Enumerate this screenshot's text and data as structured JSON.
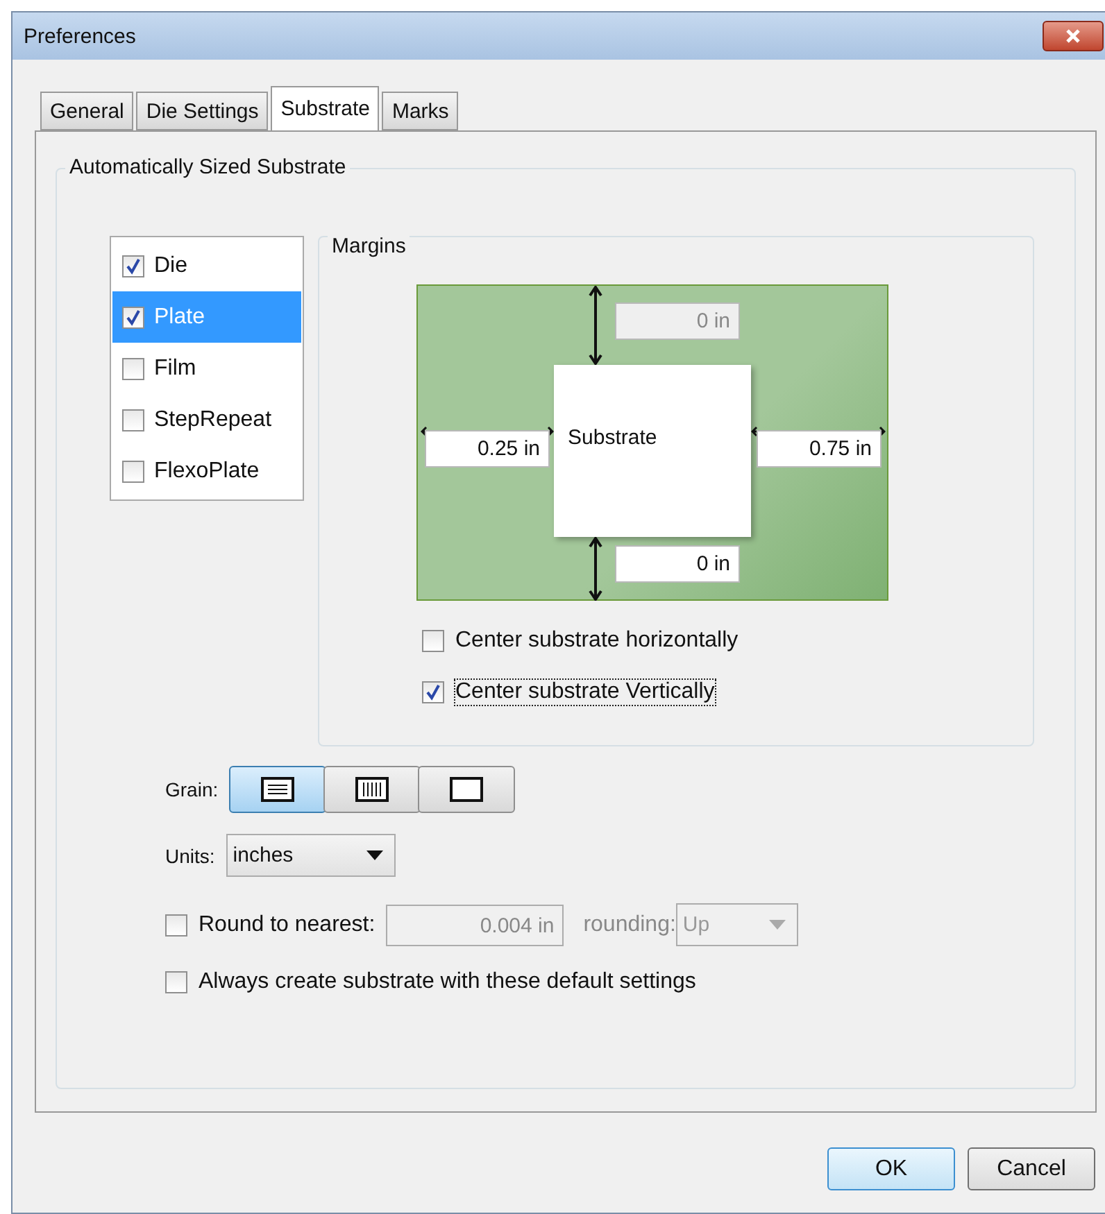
{
  "window": {
    "title": "Preferences"
  },
  "tabs": [
    {
      "label": "General",
      "selected": false
    },
    {
      "label": "Die Settings",
      "selected": false
    },
    {
      "label": "Substrate",
      "selected": true
    },
    {
      "label": "Marks",
      "selected": false
    }
  ],
  "group": {
    "title": "Automatically Sized Substrate"
  },
  "layers": [
    {
      "label": "Die",
      "checked": true,
      "selected": false
    },
    {
      "label": "Plate",
      "checked": true,
      "selected": true
    },
    {
      "label": "Film",
      "checked": false,
      "selected": false
    },
    {
      "label": "StepRepeat",
      "checked": false,
      "selected": false
    },
    {
      "label": "FlexoPlate",
      "checked": false,
      "selected": false
    }
  ],
  "margins": {
    "title": "Margins",
    "substrate_label": "Substrate",
    "top": {
      "value": "0 in",
      "disabled": true
    },
    "left": {
      "value": "0.25 in",
      "disabled": false
    },
    "right": {
      "value": "0.75 in",
      "disabled": false
    },
    "bottom": {
      "value": "0 in",
      "disabled": false
    },
    "options": [
      {
        "label": "Center substrate horizontally",
        "checked": false,
        "focused": false
      },
      {
        "label": "Center substrate Vertically",
        "checked": true,
        "focused": true
      }
    ]
  },
  "grain": {
    "label": "Grain:",
    "buttons": [
      {
        "kind": "horizontal",
        "selected": true
      },
      {
        "kind": "vertical",
        "selected": false
      },
      {
        "kind": "none",
        "selected": false
      }
    ]
  },
  "units": {
    "label": "Units:",
    "value": "inches"
  },
  "round": {
    "label": "Round to nearest:",
    "checked": false,
    "value": "0.004 in",
    "rounding_label": "rounding:",
    "rounding_value": "Up"
  },
  "always": {
    "label": "Always create substrate with these default settings",
    "checked": false
  },
  "buttons": [
    {
      "label": "OK",
      "default": true
    },
    {
      "label": "Cancel",
      "default": false
    }
  ]
}
